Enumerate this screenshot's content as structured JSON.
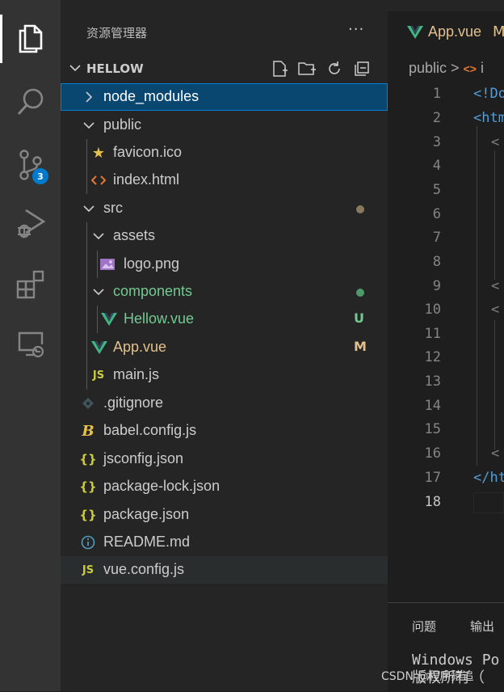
{
  "activity_bar": {
    "items": [
      {
        "name": "explorer-icon"
      },
      {
        "name": "search-icon"
      },
      {
        "name": "source-control-icon",
        "badge": "3"
      },
      {
        "name": "run-debug-icon"
      },
      {
        "name": "extensions-icon"
      },
      {
        "name": "remote-explorer-icon"
      }
    ]
  },
  "sidebar": {
    "title": "资源管理器",
    "more": "···",
    "section": "HELLOW",
    "files": [
      {
        "label": "node_modules",
        "type": "folder-closed"
      },
      {
        "label": "public",
        "type": "folder-open"
      },
      {
        "label": "favicon.ico",
        "icon": "★"
      },
      {
        "label": "index.html",
        "icon": "<>"
      },
      {
        "label": "src",
        "type": "folder-open"
      },
      {
        "label": "assets",
        "type": "folder-open"
      },
      {
        "label": "logo.png",
        "icon": "image"
      },
      {
        "label": "components",
        "type": "folder-open"
      },
      {
        "label": "Hellow.vue",
        "icon": "V",
        "status": "U"
      },
      {
        "label": "App.vue",
        "icon": "V",
        "status": "M"
      },
      {
        "label": "main.js",
        "icon": "JS"
      },
      {
        "label": ".gitignore",
        "icon": "git"
      },
      {
        "label": "babel.config.js",
        "icon": "B"
      },
      {
        "label": "jsconfig.json",
        "icon": "{}"
      },
      {
        "label": "package-lock.json",
        "icon": "{}"
      },
      {
        "label": "package.json",
        "icon": "{}"
      },
      {
        "label": "README.md",
        "icon": "i"
      },
      {
        "label": "vue.config.js",
        "icon": "JS"
      }
    ],
    "colors": {
      "modified": "#e2c08d",
      "untracked": "#73c991",
      "accent": "#007fd4"
    }
  },
  "editor": {
    "tab_label": "App.vue",
    "tab_status": "M",
    "breadcrumb_a": "public",
    "breadcrumb_sep": ">",
    "breadcrumb_b": "i",
    "lines": [
      "1",
      "2",
      "3",
      "4",
      "5",
      "6",
      "7",
      "8",
      "9",
      "10",
      "11",
      "12",
      "13",
      "14",
      "15",
      "16",
      "17",
      "18"
    ],
    "code": {
      "l1": "<!Do",
      "l2": "<htm",
      "l3": "<",
      "l9": "<",
      "l10": "<",
      "l16": "<",
      "l17": "</ht"
    }
  },
  "panel": {
    "tab_problems": "问题",
    "tab_output": "输出",
    "term_line1": "Windows Po",
    "term_line2": "版权所有（"
  },
  "watermark": "CSDN @程序猿追"
}
